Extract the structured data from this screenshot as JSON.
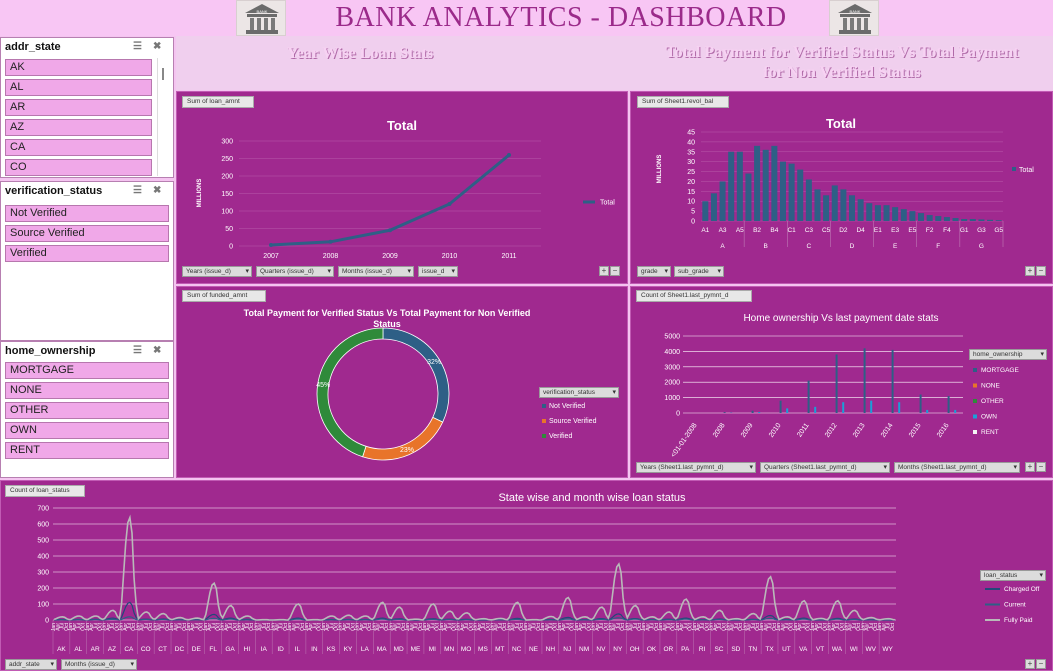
{
  "header": {
    "title": "BANK ANALYTICS - DASHBOARD",
    "logo_label": "BANK",
    "subtitle_left": "Year Wise Loan Stats",
    "subtitle_right": "Total Payment for Verified Status Vs Total Payment for Non Verified Status"
  },
  "slicers": {
    "addr_state": {
      "title": "addr_state",
      "items": [
        "AK",
        "AL",
        "AR",
        "AZ",
        "CA",
        "CO"
      ]
    },
    "verification_status": {
      "title": "verification_status",
      "items": [
        "Not Verified",
        "Source Verified",
        "Verified"
      ]
    },
    "home_ownership": {
      "title": "home_ownership",
      "items": [
        "MORTGAGE",
        "NONE",
        "OTHER",
        "OWN",
        "RENT"
      ]
    }
  },
  "panels": {
    "loan_amnt": {
      "field": "Sum of loan_amnt",
      "filters": [
        "Years (issue_d)",
        "Quarters (issue_d)",
        "Months (issue_d)",
        "issue_d"
      ]
    },
    "revol_bal": {
      "field": "Sum of Sheet1.revol_bal",
      "filters": [
        "grade",
        "sub_grade"
      ]
    },
    "funded_amnt": {
      "field": "Sum of funded_amnt",
      "filters": [
        "verification_status"
      ]
    },
    "last_pymnt": {
      "field": "Count of Sheet1.last_pymnt_d",
      "filters": [
        "home_ownership",
        "Years (Sheet1.last_pymnt_d)",
        "Quarters (Sheet1.last_pymnt_d)",
        "Months (Sheet1.last_pymnt_d)"
      ]
    },
    "loan_status": {
      "field": "Count of loan_status",
      "filters": [
        "loan_status",
        "addr_state",
        "Months (issue_d)"
      ]
    }
  },
  "chart_data": [
    {
      "type": "line",
      "title": "Total",
      "ylabel": "MILLIONS",
      "x": [
        "2007",
        "2008",
        "2009",
        "2010",
        "2011"
      ],
      "series": [
        {
          "name": "Total",
          "values": [
            3,
            12,
            45,
            120,
            260
          ]
        }
      ],
      "ylim": [
        0,
        300
      ],
      "yticks": [
        0,
        50,
        100,
        150,
        200,
        250,
        300
      ],
      "legend": "right",
      "color": "#2e5f86"
    },
    {
      "type": "bar",
      "title": "Total",
      "ylabel": "MILLIONS",
      "categories": [
        "A1",
        "A2",
        "A3",
        "A4",
        "A5",
        "B1",
        "B2",
        "B3",
        "B4",
        "B5",
        "C1",
        "C2",
        "C3",
        "C4",
        "C5",
        "D1",
        "D2",
        "D3",
        "D4",
        "D5",
        "E1",
        "E2",
        "E3",
        "E4",
        "E5",
        "F1",
        "F2",
        "F3",
        "F4",
        "F5",
        "G1",
        "G2",
        "G3",
        "G4",
        "G5"
      ],
      "tick_labels": [
        "A1",
        "A3",
        "A5",
        "B2",
        "B4",
        "C1",
        "C3",
        "C5",
        "D2",
        "D4",
        "E1",
        "E3",
        "E5",
        "F2",
        "F4",
        "G1",
        "G3",
        "G5"
      ],
      "groups": [
        "A",
        "B",
        "C",
        "D",
        "E",
        "F",
        "G"
      ],
      "series": [
        {
          "name": "Total",
          "values": [
            10,
            14,
            20,
            35,
            35,
            24,
            38,
            36,
            38,
            30,
            29,
            26,
            21,
            16,
            13,
            18,
            16,
            13,
            11,
            9,
            8,
            8,
            7,
            6,
            5,
            4,
            3,
            2.5,
            2,
            1.5,
            1,
            1,
            0.8,
            0.6,
            0.4
          ]
        }
      ],
      "ylim": [
        0,
        45
      ],
      "yticks": [
        0,
        5,
        10,
        15,
        20,
        25,
        30,
        35,
        40,
        45
      ],
      "legend": "right",
      "color": "#2e5f86"
    },
    {
      "type": "pie",
      "title": "Total Payment for Verified Status Vs Total Payment for Non Verified Status",
      "labels": [
        "Not Verified",
        "Source Verified",
        "Verified"
      ],
      "values": [
        32,
        23,
        45
      ],
      "value_labels": [
        "32%",
        "23%",
        "45%"
      ],
      "colors": [
        "#2e5f86",
        "#e8742a",
        "#2f8a3a"
      ],
      "legend": "right"
    },
    {
      "type": "bar",
      "title": "Home ownership Vs last payment date stats",
      "x": [
        "<01-01-2008",
        "2008",
        "2009",
        "2010",
        "2011",
        "2012",
        "2013",
        "2014",
        "2015",
        "2016"
      ],
      "series": [
        {
          "name": "MORTGAGE",
          "values": [
            0,
            50,
            150,
            800,
            2100,
            3800,
            4200,
            4100,
            1200,
            1100
          ]
        },
        {
          "name": "NONE",
          "values": [
            0,
            0,
            0,
            0,
            0,
            0,
            0,
            0,
            0,
            0
          ]
        },
        {
          "name": "OTHER",
          "values": [
            0,
            0,
            0,
            0,
            0,
            0,
            0,
            0,
            0,
            0
          ]
        },
        {
          "name": "OWN",
          "values": [
            0,
            20,
            60,
            300,
            400,
            700,
            800,
            700,
            200,
            200
          ]
        },
        {
          "name": "RENT",
          "values": [
            0,
            0,
            0,
            0,
            0,
            0,
            0,
            0,
            0,
            0
          ]
        }
      ],
      "colors": [
        "#2e5f86",
        "#e8742a",
        "#2f8a3a",
        "#1aa0d8",
        "#f4f4f4"
      ],
      "ylim": [
        0,
        5000
      ],
      "yticks": [
        0,
        1000,
        2000,
        3000,
        4000,
        5000
      ],
      "legend": "right"
    },
    {
      "type": "line",
      "title": "State wise and month wise loan status",
      "ylim": [
        0,
        700
      ],
      "yticks": [
        0,
        100,
        200,
        300,
        400,
        500,
        600,
        700
      ],
      "states": [
        "AK",
        "AL",
        "AR",
        "AZ",
        "CA",
        "CO",
        "CT",
        "DC",
        "DE",
        "FL",
        "GA",
        "HI",
        "IA",
        "ID",
        "IL",
        "IN",
        "KS",
        "KY",
        "LA",
        "MA",
        "MD",
        "ME",
        "MI",
        "MN",
        "MO",
        "MS",
        "MT",
        "NC",
        "NE",
        "NH",
        "NJ",
        "NM",
        "NV",
        "NY",
        "OH",
        "OK",
        "OR",
        "PA",
        "RI",
        "SC",
        "SD",
        "TN",
        "TX",
        "UT",
        "VA",
        "VT",
        "WA",
        "WI",
        "WV",
        "WY"
      ],
      "months_repeat": [
        "Jan",
        "Apr",
        "Jul",
        "Oct"
      ],
      "series": [
        {
          "name": "Charged Off",
          "state_peaks": [
            3,
            3,
            4,
            12,
            110,
            5,
            6,
            2,
            2,
            35,
            12,
            4,
            0,
            0,
            12,
            0,
            3,
            3,
            3,
            12,
            8,
            0,
            8,
            5,
            4,
            1,
            1,
            10,
            0,
            3,
            16,
            2,
            9,
            38,
            9,
            3,
            5,
            12,
            2,
            6,
            1,
            4,
            28,
            3,
            12,
            1,
            10,
            6,
            2,
            1
          ]
        },
        {
          "name": "Current",
          "state_peaks": [
            1,
            2,
            2,
            4,
            20,
            3,
            3,
            1,
            1,
            10,
            5,
            1,
            0,
            0,
            6,
            0,
            1,
            2,
            2,
            5,
            4,
            0,
            4,
            3,
            2,
            0,
            1,
            4,
            0,
            1,
            6,
            1,
            4,
            14,
            5,
            2,
            2,
            5,
            1,
            3,
            0,
            2,
            10,
            1,
            5,
            0,
            5,
            3,
            1,
            0
          ]
        },
        {
          "name": "Fully Paid",
          "state_peaks": [
            20,
            25,
            25,
            60,
            640,
            50,
            40,
            15,
            12,
            230,
            90,
            25,
            2,
            2,
            100,
            2,
            25,
            30,
            25,
            110,
            80,
            5,
            100,
            55,
            45,
            8,
            10,
            110,
            2,
            22,
            140,
            20,
            80,
            350,
            90,
            20,
            50,
            130,
            20,
            60,
            8,
            40,
            270,
            20,
            120,
            10,
            120,
            60,
            15,
            8
          ]
        }
      ],
      "colors": [
        "#23487a",
        "#2e5f86",
        "#b9b9b9"
      ],
      "legend": "right"
    }
  ]
}
